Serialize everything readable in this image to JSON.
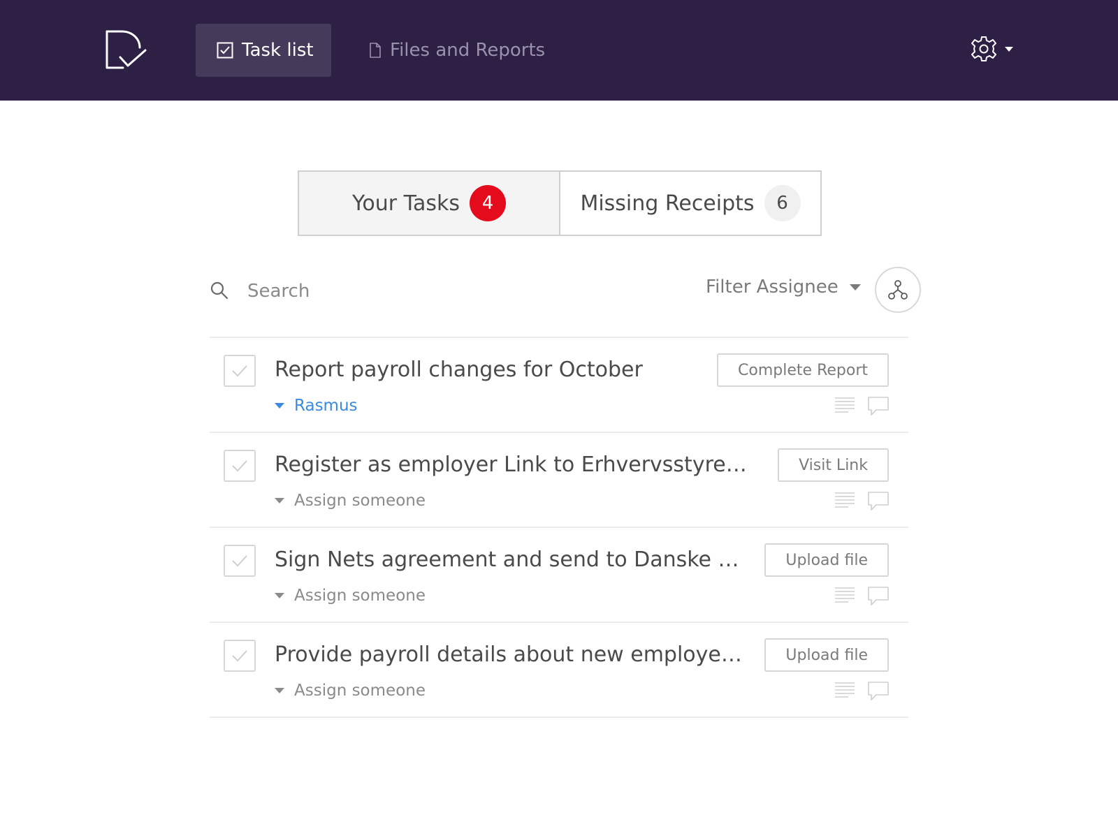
{
  "nav": {
    "logo_icon": "check-document-logo-icon",
    "tabs": [
      {
        "label": "Task list",
        "icon": "checkbox-icon",
        "active": true
      },
      {
        "label": "Files and Reports",
        "icon": "document-icon",
        "active": false
      }
    ],
    "settings_icon": "gear-icon"
  },
  "segments": [
    {
      "label": "Your Tasks",
      "count": "4",
      "active": true
    },
    {
      "label": "Missing Receipts",
      "count": "6",
      "active": false
    }
  ],
  "search": {
    "placeholder": "Search"
  },
  "filter": {
    "label": "Filter Assignee"
  },
  "tasks": [
    {
      "title": "Report payroll changes for October",
      "assignee": "Rasmus",
      "action": "Complete Report"
    },
    {
      "title": "Register as employer Link to Erhvervsstyrelsen",
      "assignee": "Assign someone",
      "action": "Visit Link"
    },
    {
      "title": "Sign Nets agreement and send to Danske Bank",
      "assignee": "Assign someone",
      "action": "Upload file"
    },
    {
      "title": "Provide payroll details about new employee, Lars Hansen",
      "assignee": "Assign someone",
      "action": "Upload file"
    }
  ],
  "colors": {
    "nav_bg": "#2e1f45",
    "badge_red": "#e30b1c",
    "link_blue": "#3a8be0"
  }
}
